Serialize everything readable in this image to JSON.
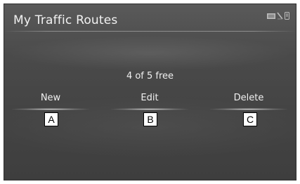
{
  "screen": {
    "title": "My Traffic Routes",
    "free_status": "4 of 5 free",
    "status_icons": [
      "signal-icon",
      "no-connection-icon",
      "phone-icon"
    ]
  },
  "actions": [
    {
      "label": "New",
      "callout": "A"
    },
    {
      "label": "Edit",
      "callout": "B"
    },
    {
      "label": "Delete",
      "callout": "C"
    }
  ]
}
